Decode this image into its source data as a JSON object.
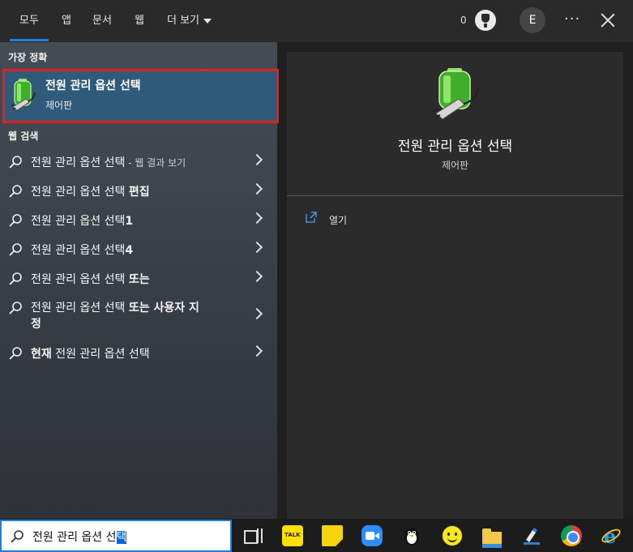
{
  "tabs": [
    {
      "label": "모두",
      "active": true
    },
    {
      "label": "앱",
      "active": false
    },
    {
      "label": "문서",
      "active": false
    },
    {
      "label": "웹",
      "active": false
    },
    {
      "label": "더 보기",
      "active": false
    }
  ],
  "header": {
    "counter": "0",
    "avatar_initial": "E",
    "more_label": "···",
    "trophy_icon": "trophy-icon",
    "close_icon": "close-icon"
  },
  "best_match": {
    "section_label": "가장 정확",
    "title": "전원 관리 옵션 선택",
    "subtitle": "제어판",
    "icon": "battery-plug-icon"
  },
  "web_search": {
    "section_label": "웹 검색",
    "results": [
      {
        "normal": "전원 관리 옵션 선택",
        "bold": "",
        "suffix": " - 웹 결과 보기",
        "line2": ""
      },
      {
        "normal": "전원 관리 옵션 선택 ",
        "bold": "편집",
        "suffix": "",
        "line2": ""
      },
      {
        "normal": "전원 관리 옵션 선택",
        "bold": "1",
        "suffix": "",
        "line2": ""
      },
      {
        "normal": "전원 관리 옵션 선택",
        "bold": "4",
        "suffix": "",
        "line2": ""
      },
      {
        "normal": "전원 관리 옵션 선택 ",
        "bold": "또는",
        "suffix": "",
        "line2": ""
      },
      {
        "normal": "전원 관리 옵션 선택 ",
        "bold": "또는 사용자 지",
        "suffix": "",
        "line2": "정"
      },
      {
        "prefix_bold": "현재",
        "normal": " 전원 관리 옵션 선택",
        "bold": "",
        "suffix": "",
        "line2": ""
      }
    ]
  },
  "preview": {
    "title": "전원 관리 옵션 선택",
    "subtitle": "제어판",
    "open_label": "열기"
  },
  "search": {
    "value_unselected": "전원 관리 옵션 선",
    "value_selected": "택"
  },
  "taskbar": {
    "talk_label": "TALK",
    "icons": [
      "task-view-icon",
      "kakaotalk-icon",
      "sticky-notes-icon",
      "zoom-icon",
      "penguin-icon",
      "smiley-icon",
      "file-explorer-icon",
      "pen-app-icon",
      "chrome-icon",
      "internet-explorer-icon"
    ]
  },
  "colors": {
    "accent": "#1e7fe0",
    "highlight_border": "#e41f1f",
    "best_match_bg": "#305a79"
  }
}
